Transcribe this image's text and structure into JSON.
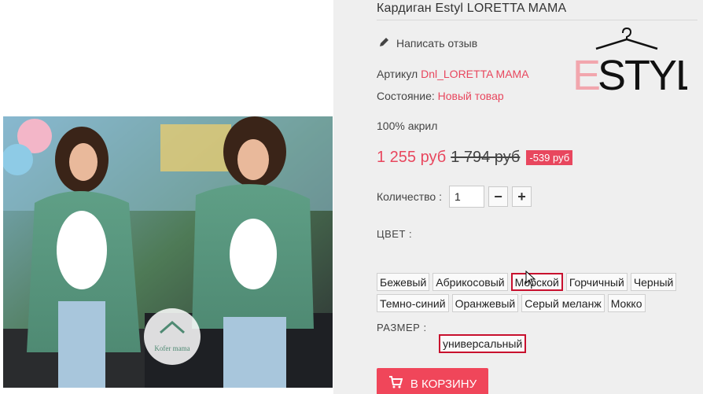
{
  "product": {
    "title": "Кардиган Estyl LORETTA MAMA",
    "review_link": "Написать отзыв",
    "sku_label": "Артикул",
    "sku_value": "Dnl_LORETTA MAMA",
    "condition_label": "Состояние:",
    "condition_value": "Новый товар",
    "composition": "100% акрил",
    "brand_logo": {
      "letter": "E",
      "text": "STYL",
      "icon": "hanger-icon"
    }
  },
  "price": {
    "current": "1 255 руб",
    "old": "1 794 руб",
    "discount": "-539 руб"
  },
  "quantity": {
    "label": "Количество :",
    "value": "1",
    "minus": "−",
    "plus": "+"
  },
  "color": {
    "label": "ЦВЕТ :",
    "options": [
      "Бежевый",
      "Абрикосовый",
      "Морской",
      "Горчичный",
      "Черный",
      "Темно-синий",
      "Оранжевый",
      "Серый меланж",
      "Мокко"
    ],
    "selected": "Морской"
  },
  "size": {
    "label": "РАЗМЕР :",
    "selected": "универсальный"
  },
  "cart": {
    "label": "В КОРЗИНУ",
    "icon": "cart-icon"
  },
  "photo": {
    "watermark": "Kofer mama"
  },
  "colors": {
    "accent": "#e8475e",
    "selected_border": "#c8102e"
  }
}
